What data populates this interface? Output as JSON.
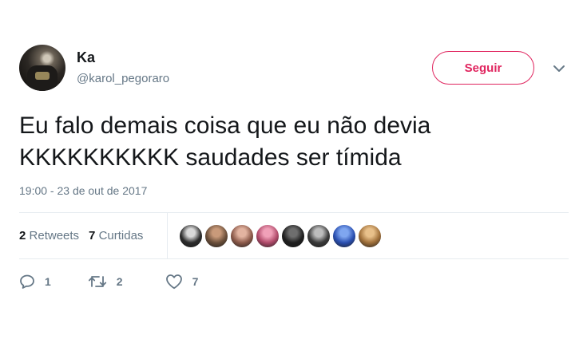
{
  "author": {
    "name": "Ka",
    "handle": "@karol_pegoraro"
  },
  "follow_button": "Seguir",
  "tweet": {
    "lines": [
      "Eu falo demais coisa que eu não devia",
      "KKKKKKKKKK saudades ser tímida"
    ],
    "timestamp": "19:00 - 23 de out de 2017"
  },
  "stats": {
    "retweets_count": "2",
    "retweets_label": "Retweets",
    "likes_count": "7",
    "likes_label": "Curtidas"
  },
  "likers": [
    {
      "color": "#2b2b2b",
      "accent": "#d9d9d9"
    },
    {
      "color": "#6b4f3a",
      "accent": "#c99a7a"
    },
    {
      "color": "#8c5a4a",
      "accent": "#e2b3a0"
    },
    {
      "color": "#b04a6a",
      "accent": "#f0a0b8"
    },
    {
      "color": "#1e1e1e",
      "accent": "#6e6e6e"
    },
    {
      "color": "#3a3a3a",
      "accent": "#bdbdbd"
    },
    {
      "color": "#2a4fb0",
      "accent": "#7fa6f0"
    },
    {
      "color": "#a0703a",
      "accent": "#e8c08a"
    }
  ],
  "actions": {
    "reply_count": "1",
    "retweet_count": "2",
    "like_count": "7"
  },
  "colors": {
    "accent": "#e0245e",
    "secondary_text": "#657786",
    "divider": "#e6ecf0"
  }
}
